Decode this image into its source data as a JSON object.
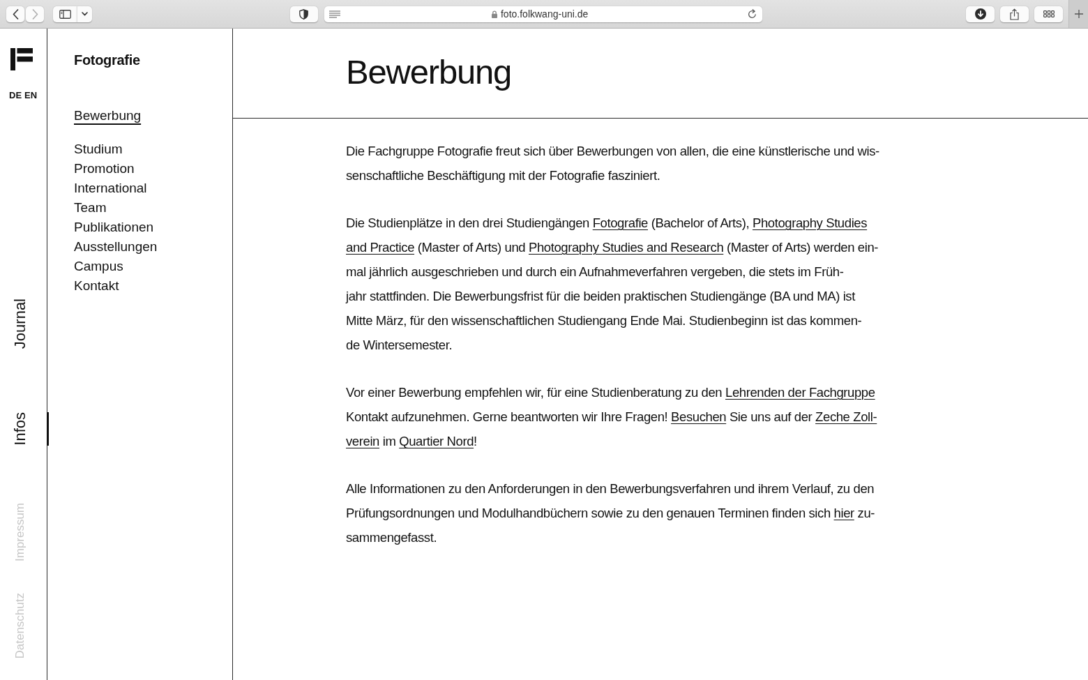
{
  "browser": {
    "nav_buttons": [
      {
        "kind": "back",
        "disabled": false
      },
      {
        "kind": "forward",
        "disabled": true
      }
    ],
    "url": "foto.folkwang-uni.de"
  },
  "rail": {
    "languages": [
      "DE",
      "EN"
    ],
    "items": [
      {
        "label": "Journal",
        "kind": "main",
        "selected": false
      },
      {
        "label": "Infos",
        "kind": "main",
        "selected": true
      },
      {
        "label": "Impressum",
        "kind": "legal",
        "selected": false
      },
      {
        "label": "Datenschutz",
        "kind": "legal",
        "selected": false
      }
    ]
  },
  "subnav": {
    "title": "Fotografie",
    "groups": [
      {
        "items": [
          {
            "label": "Bewerbung",
            "selected": true
          }
        ]
      },
      {
        "items": [
          {
            "label": "Studium",
            "selected": false
          },
          {
            "label": "Promotion",
            "selected": false
          },
          {
            "label": "International",
            "selected": false
          },
          {
            "label": "Team",
            "selected": false
          },
          {
            "label": "Publikationen",
            "selected": false
          },
          {
            "label": "Ausstellungen",
            "selected": false
          },
          {
            "label": "Campus",
            "selected": false
          },
          {
            "label": "Kontakt",
            "selected": false
          }
        ]
      }
    ]
  },
  "main": {
    "title": "Bewerbung",
    "paragraphs": [
      {
        "lines": [
          [
            {
              "kind": "text",
              "text": "Die Fachgruppe Fotografie freut sich über Bewerbungen von allen, die eine künstlerische und wis-"
            }
          ],
          [
            {
              "kind": "text",
              "text": "senschaftliche Beschäftigung mit der Fotografie fasziniert."
            }
          ]
        ]
      },
      {
        "lines": [
          [
            {
              "kind": "text",
              "text": "Die Studienplätze in den drei Studiengängen "
            },
            {
              "kind": "link",
              "text": "Fotografie"
            },
            {
              "kind": "text",
              "text": " (Bachelor of Arts), "
            },
            {
              "kind": "link",
              "text": "Photography Studies"
            }
          ],
          [
            {
              "kind": "link",
              "text": "and Practice"
            },
            {
              "kind": "text",
              "text": " (Master of Arts) und "
            },
            {
              "kind": "link",
              "text": "Photography Studies and Research"
            },
            {
              "kind": "text",
              "text": " (Master of Arts) werden ein-"
            }
          ],
          [
            {
              "kind": "text",
              "text": "mal jährlich ausgeschrieben und durch ein Aufnahmeverfahren vergeben, die stets im Früh-"
            }
          ],
          [
            {
              "kind": "text",
              "text": "jahr stattfinden. Die Bewerbungsfrist für die beiden praktischen Studiengänge (BA und MA) ist"
            }
          ],
          [
            {
              "kind": "text",
              "text": "Mitte März, für den wissenschaftlichen Studiengang Ende Mai. Studienbeginn ist das kommen-"
            }
          ],
          [
            {
              "kind": "text",
              "text": "de Wintersemester."
            }
          ]
        ]
      },
      {
        "lines": [
          [
            {
              "kind": "text",
              "text": "Vor einer Bewerbung empfehlen wir, für eine Studienberatung zu den "
            },
            {
              "kind": "link",
              "text": "Lehrenden der Fachgruppe"
            }
          ],
          [
            {
              "kind": "text",
              "text": "Kontakt aufzunehmen. Gerne beantworten wir Ihre Fragen! "
            },
            {
              "kind": "link",
              "text": "Besuchen"
            },
            {
              "kind": "text",
              "text": " Sie uns auf der "
            },
            {
              "kind": "link",
              "text": "Zeche Zoll-"
            }
          ],
          [
            {
              "kind": "link",
              "text": "verein"
            },
            {
              "kind": "text",
              "text": " im "
            },
            {
              "kind": "link",
              "text": "Quartier Nord"
            },
            {
              "kind": "text",
              "text": "!"
            }
          ]
        ]
      },
      {
        "lines": [
          [
            {
              "kind": "text",
              "text": "Alle Informationen zu den Anforderungen in den Bewerbungsverfahren und ihrem Verlauf, zu den"
            }
          ],
          [
            {
              "kind": "text",
              "text": "Prüfungsordnungen und Modulhandbüchern sowie zu den genauen Terminen finden sich "
            },
            {
              "kind": "link",
              "text": "hier"
            },
            {
              "kind": "text",
              "text": " zu-"
            }
          ],
          [
            {
              "kind": "text",
              "text": "sammengefasst."
            }
          ]
        ]
      }
    ]
  }
}
